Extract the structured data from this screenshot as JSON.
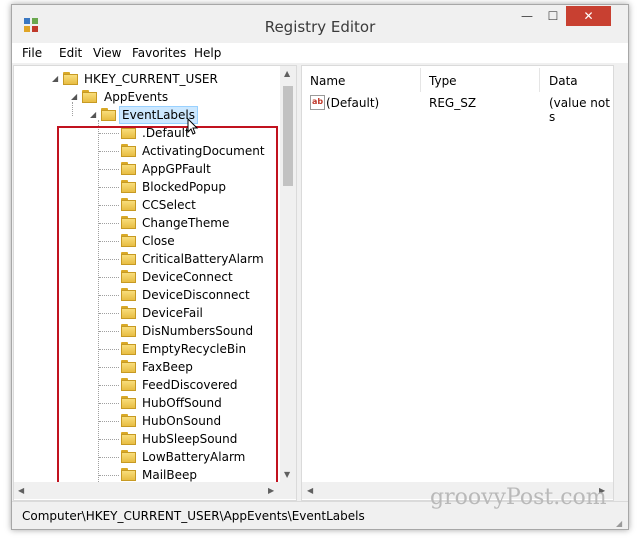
{
  "window": {
    "title": "Registry Editor"
  },
  "titlebar_buttons": {
    "minimize": "—",
    "maximize": "☐",
    "close": "✕"
  },
  "menu": [
    "File",
    "Edit",
    "View",
    "Favorites",
    "Help"
  ],
  "tree": {
    "root": "HKEY_CURRENT_USER",
    "parent": "AppEvents",
    "selected": "EventLabels",
    "children": [
      ".Default",
      "ActivatingDocument",
      "AppGPFault",
      "BlockedPopup",
      "CCSelect",
      "ChangeTheme",
      "Close",
      "CriticalBatteryAlarm",
      "DeviceConnect",
      "DeviceDisconnect",
      "DeviceFail",
      "DisNumbersSound",
      "EmptyRecycleBin",
      "FaxBeep",
      "FeedDiscovered",
      "HubOffSound",
      "HubOnSound",
      "HubSleepSound",
      "LowBatteryAlarm",
      "MailBeep"
    ]
  },
  "list": {
    "columns": [
      "Name",
      "Type",
      "Data"
    ],
    "rows": [
      {
        "name": "(Default)",
        "type": "REG_SZ",
        "data": "(value not s"
      }
    ]
  },
  "status": "Computer\\HKEY_CURRENT_USER\\AppEvents\\EventLabels",
  "watermark": "groovyPost.com",
  "colors": {
    "highlight_box": "#c1121f",
    "selection": "#cce8ff",
    "close_button": "#c84031"
  },
  "icons": {
    "app": "registry-icon",
    "folder": "folder-icon",
    "value": "string-value-icon"
  }
}
